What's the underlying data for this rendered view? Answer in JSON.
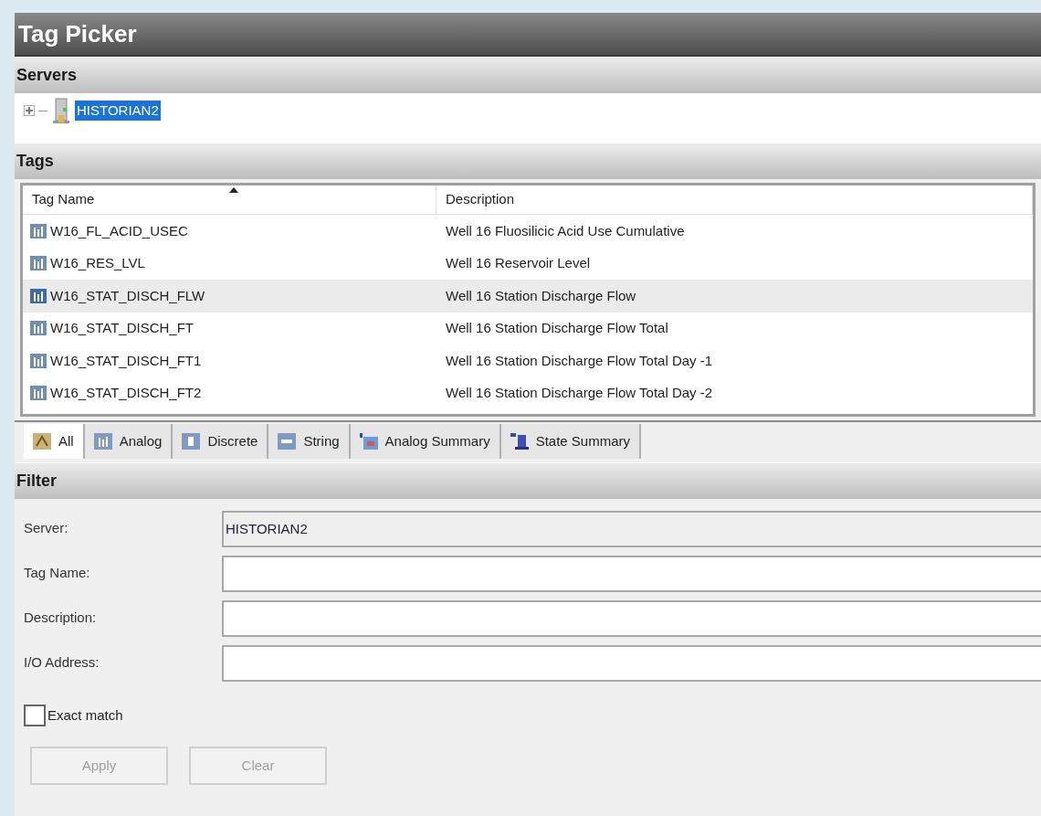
{
  "window": {
    "title": "Tag Picker"
  },
  "servers": {
    "title": "Servers",
    "items": [
      {
        "label": "HISTORIAN2",
        "expanded": false,
        "selected": true
      }
    ]
  },
  "tags": {
    "title": "Tags",
    "columns": [
      {
        "label": "Tag Name",
        "sorted": true
      },
      {
        "label": "Description",
        "sorted": false
      }
    ],
    "rows": [
      {
        "name": "W16_FL_ACID_USEC",
        "description": "Well 16 Fluosilicic Acid Use Cumulative",
        "selected": false
      },
      {
        "name": "W16_RES_LVL",
        "description": "Well 16 Reservoir Level",
        "selected": false
      },
      {
        "name": "W16_STAT_DISCH_FLW",
        "description": "Well 16 Station Discharge Flow",
        "selected": true
      },
      {
        "name": "W16_STAT_DISCH_FT",
        "description": "Well 16 Station Discharge Flow Total",
        "selected": false
      },
      {
        "name": "W16_STAT_DISCH_FT1",
        "description": "Well 16 Station Discharge Flow Total Day -1",
        "selected": false
      },
      {
        "name": "W16_STAT_DISCH_FT2",
        "description": "Well 16 Station Discharge Flow Total Day -2",
        "selected": false
      }
    ]
  },
  "tabs": [
    {
      "label": "All",
      "kind": "all",
      "selected": true
    },
    {
      "label": "Analog",
      "kind": "analog",
      "selected": false
    },
    {
      "label": "Discrete",
      "kind": "discrete",
      "selected": false
    },
    {
      "label": "String",
      "kind": "string",
      "selected": false
    },
    {
      "label": "Analog Summary",
      "kind": "analog-summary",
      "selected": false
    },
    {
      "label": "State Summary",
      "kind": "state-summary",
      "selected": false
    }
  ],
  "filter": {
    "title": "Filter",
    "fields": [
      {
        "label": "Server:",
        "value": "HISTORIAN2",
        "disabled": true
      },
      {
        "label": "Tag Name:",
        "disabled": false
      },
      {
        "label": "Description:",
        "disabled": false
      },
      {
        "label": "I/O Address:",
        "disabled": false
      }
    ],
    "exact_match": {
      "label": "Exact match",
      "checked": false
    },
    "buttons": [
      {
        "label": "Apply",
        "disabled": true
      },
      {
        "label": "Clear",
        "disabled": true
      }
    ]
  }
}
